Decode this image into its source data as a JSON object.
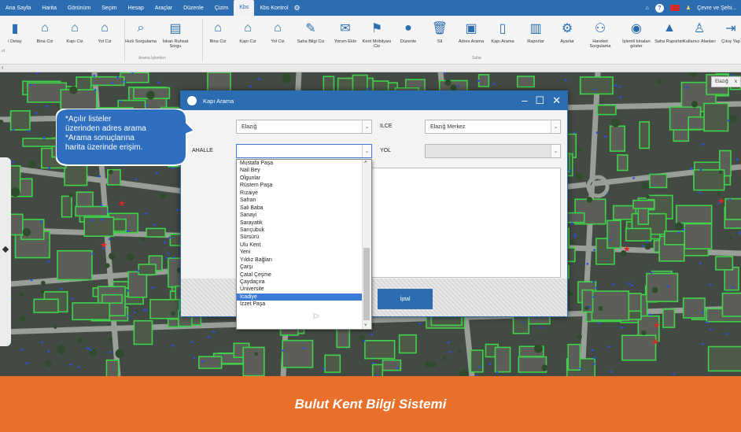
{
  "menubar": {
    "items": [
      "Ana Sayfa",
      "Harita",
      "Görünüm",
      "Seçim",
      "Hesap",
      "Araçlar",
      "Düzenle",
      "Çizim",
      "Kbs",
      "Kbs Kontrol"
    ],
    "active_index": 8,
    "right_label": "Çevre ve Şehi..."
  },
  "ribbon": {
    "buttons": [
      "i Detay",
      "Bina Ciz",
      "Kapı Ciz",
      "Yol Ciz",
      "Hızlı Sorgulama",
      "İskan Ruhsat Sorgu",
      "Bina Ciz",
      "Kapı Ciz",
      "Yol Ciz",
      "Saha Bilgi Ciz",
      "Yorum Ekle",
      "Kent Mobilyası Ciz",
      "Düzenle",
      "Sil",
      "Adres Arama",
      "Kapı Arama",
      "Raporlar",
      "Ayarlar",
      "Hareket Sorgulama",
      "İşlemli binaları göster",
      "Saha Raporları",
      "Kullanıcı Alanları",
      "Çıkış Yap"
    ],
    "group_labels": [
      "Arama İşlemleri",
      "Saha"
    ],
    "left_marker": "ıd"
  },
  "map_tab": {
    "label": "Elazığ",
    "close": "x"
  },
  "bubble": {
    "lines": [
      "*Açılır listeler",
      "üzerinden adres arama",
      "*Arama sonuçlarına",
      "harita üzerinde erişim."
    ]
  },
  "dialog": {
    "title": "Kapı Arama",
    "il_value": "Elazığ",
    "ilce_label": "ILCE",
    "ilce_value": "Elazığ Merkez",
    "mahalle_label": "AHALLE",
    "yol_label": "YOL",
    "cancel_label": "İptal"
  },
  "dropdown": {
    "options": [
      "Mustafa Paşa",
      "Nail Bey",
      "Olgunlar",
      "Rüstem Paşa",
      "Rızaiye",
      "Safran",
      "Sali Baba",
      "Sanayi",
      "Sarayatik",
      "Sarıçubuk",
      "Sürsürü",
      "Ulu Kent",
      "Yeni",
      "Yıldız Bağları",
      "Çarşı",
      "Çatal Çeşme",
      "Çaydaçıra",
      "Üniversite",
      "İcadiye",
      "İzzet Paşa"
    ],
    "selected": "İcadiye"
  },
  "footer": {
    "caption": "Bulut Kent Bilgi Sistemi"
  },
  "colors": {
    "accent": "#2b6db0",
    "footer": "#e8702a",
    "parcel": "#3fd24a",
    "door": "#2a4fe0",
    "highlight": "#3b7ad6"
  }
}
